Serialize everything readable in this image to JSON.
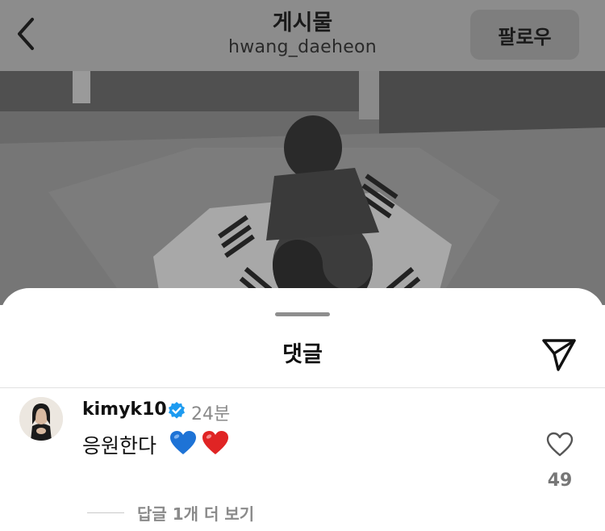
{
  "header": {
    "title": "게시물",
    "subtitle": "hwang_daeheon",
    "follow_label": "팔로우"
  },
  "sheet": {
    "title": "댓글"
  },
  "comment": {
    "username": "kimyk10",
    "verified": true,
    "time": "24분",
    "text": "응원한다",
    "emojis": [
      "blue-heart",
      "red-heart"
    ],
    "likes": "49",
    "view_replies": "답글 1개 더 보기"
  },
  "colors": {
    "verified_blue": "#1d9bf0",
    "blue_heart": "#1e73d6",
    "red_heart": "#e02424"
  },
  "icons": {
    "back": "chevron-left-icon",
    "share": "paper-plane-icon",
    "like": "heart-outline-icon"
  }
}
